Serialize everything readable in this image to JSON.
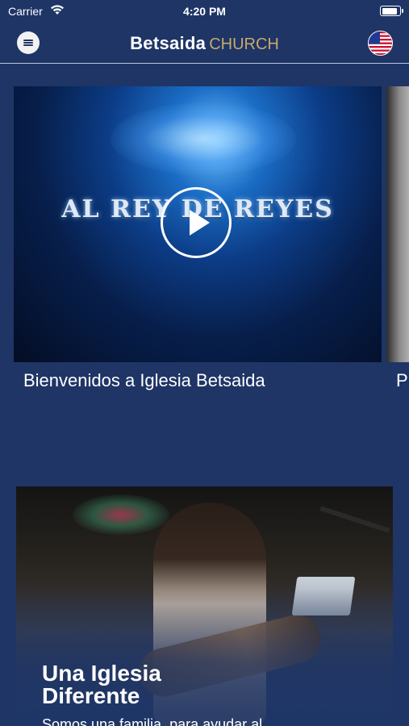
{
  "status_bar": {
    "carrier": "Carrier",
    "time": "4:20 PM",
    "battery_level": 0.9
  },
  "nav": {
    "brand_name": "Betsaida",
    "brand_suffix": "CHURCH",
    "menu_icon": "hamburger-icon",
    "language_icon": "us-flag-icon"
  },
  "videos": [
    {
      "overlay_title": "AL REY DE REYES",
      "title": "Bienvenidos a Iglesia Betsaida",
      "play_icon": "play-icon"
    },
    {
      "title": "P"
    }
  ],
  "feature": {
    "heading": "Una Iglesia Diferente",
    "body": "Somos una familia, para ayudar al"
  },
  "colors": {
    "background": "#1e3566",
    "brand_accent": "#c9a76c"
  }
}
